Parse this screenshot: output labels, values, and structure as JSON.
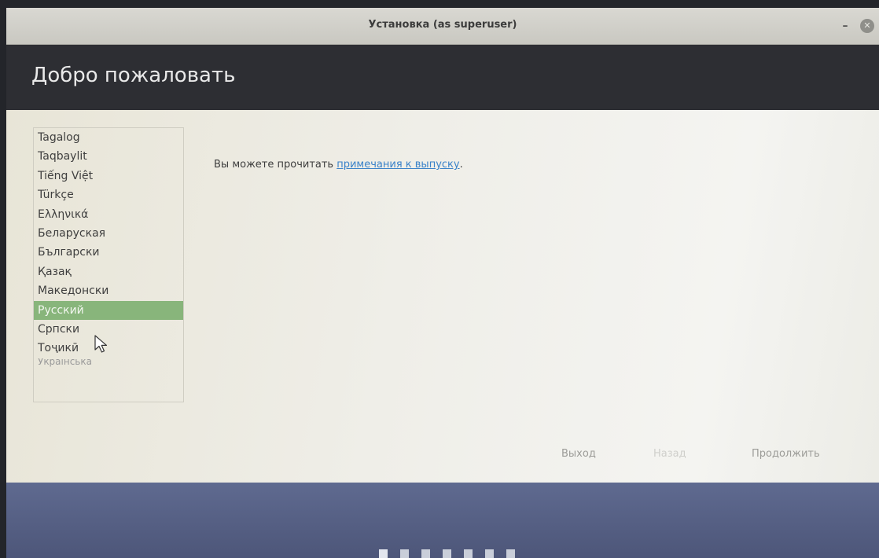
{
  "window": {
    "title": "Установка (as superuser)",
    "minimize_glyph": "–",
    "close_glyph": "✕"
  },
  "header": {
    "title": "Добро пожаловать"
  },
  "language_list": {
    "items": [
      "Tagalog",
      "Taqbaylit",
      "Tiếng Việt",
      "Türkçe",
      "Ελληνικά",
      "Беларуская",
      "Български",
      "Қазақ",
      "Македонски",
      "Русский",
      "Српски",
      "Тоҷикӣ",
      "Українська"
    ],
    "selected": "Русский"
  },
  "release_notes": {
    "prefix": "Вы можете прочитать ",
    "link": "примечания к выпуску",
    "suffix": "."
  },
  "buttons": {
    "quit": "Выход",
    "back": "Назад",
    "continue": "Продолжить"
  },
  "progress": {
    "steps": 7,
    "current_step": 1
  },
  "colors": {
    "selection": "#88b57b",
    "link": "#3a82c9",
    "header_bg": "#2d2e33",
    "footer_bg": "#5f6a90"
  },
  "icons": {
    "cursor": "pointer-cursor-icon"
  }
}
